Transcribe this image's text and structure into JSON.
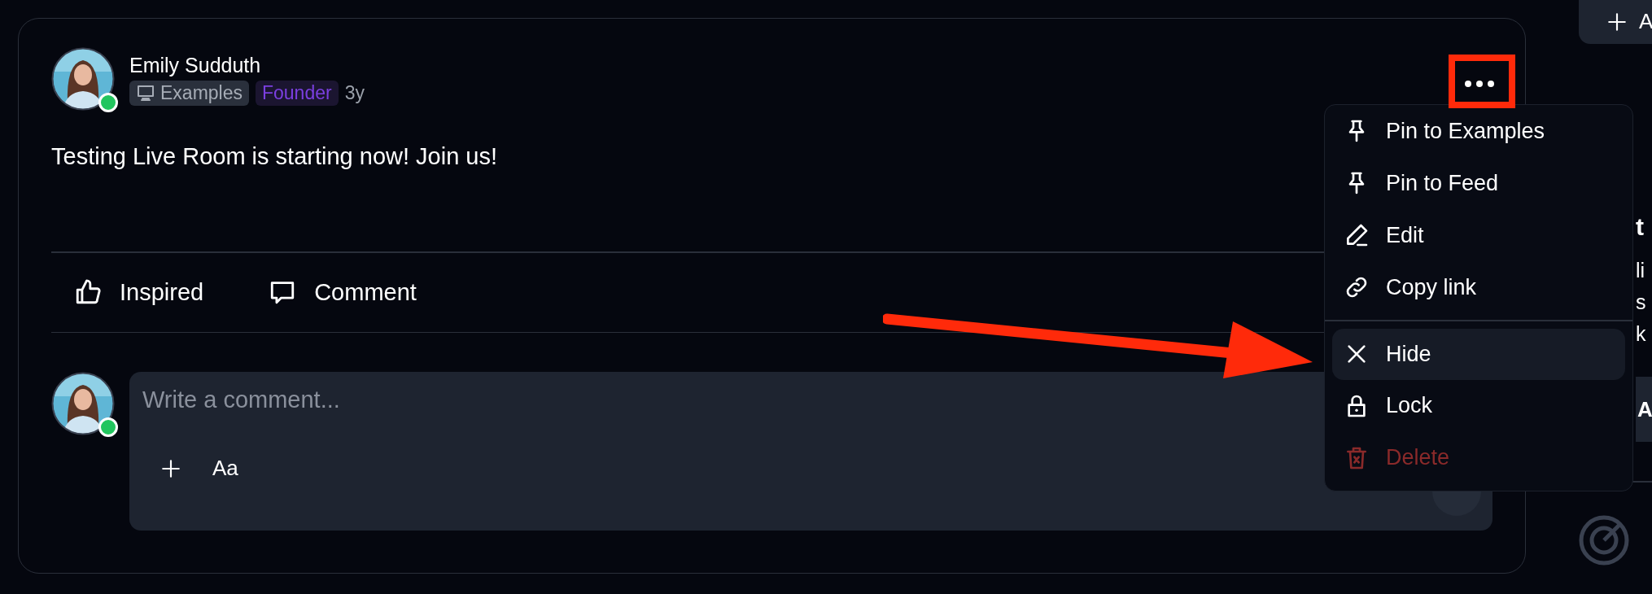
{
  "post": {
    "author": "Emily Sudduth",
    "online": true,
    "space": "Examples",
    "role": "Founder",
    "age": "3y",
    "text": "Testing Live Room is starting now! Join us!",
    "actions": [
      {
        "kind": "like",
        "label": "Inspired"
      },
      {
        "kind": "comment",
        "label": "Comment"
      }
    ]
  },
  "composer": {
    "online": true,
    "placeholder": "Write a comment...",
    "format_label": "Aa"
  },
  "menu": {
    "items": [
      {
        "kind": "pin",
        "label": "Pin to Examples",
        "highlighted": false,
        "danger": false,
        "divider_before": false
      },
      {
        "kind": "pin",
        "label": "Pin to Feed",
        "highlighted": false,
        "danger": false,
        "divider_before": false
      },
      {
        "kind": "edit",
        "label": "Edit",
        "highlighted": false,
        "danger": false,
        "divider_before": false
      },
      {
        "kind": "link",
        "label": "Copy link",
        "highlighted": false,
        "danger": false,
        "divider_before": false
      },
      {
        "kind": "hide",
        "label": "Hide",
        "highlighted": true,
        "danger": false,
        "divider_before": true
      },
      {
        "kind": "lock",
        "label": "Lock",
        "highlighted": false,
        "danger": false,
        "divider_before": false
      },
      {
        "kind": "delete",
        "label": "Delete",
        "highlighted": false,
        "danger": true,
        "divider_before": false
      }
    ]
  },
  "annotations": {
    "box_on_more_button": true,
    "arrow_to_hide": true
  },
  "sidebar": {
    "button": "A",
    "heading": "t",
    "lines": [
      "li",
      "s",
      "k"
    ],
    "card": "A"
  }
}
